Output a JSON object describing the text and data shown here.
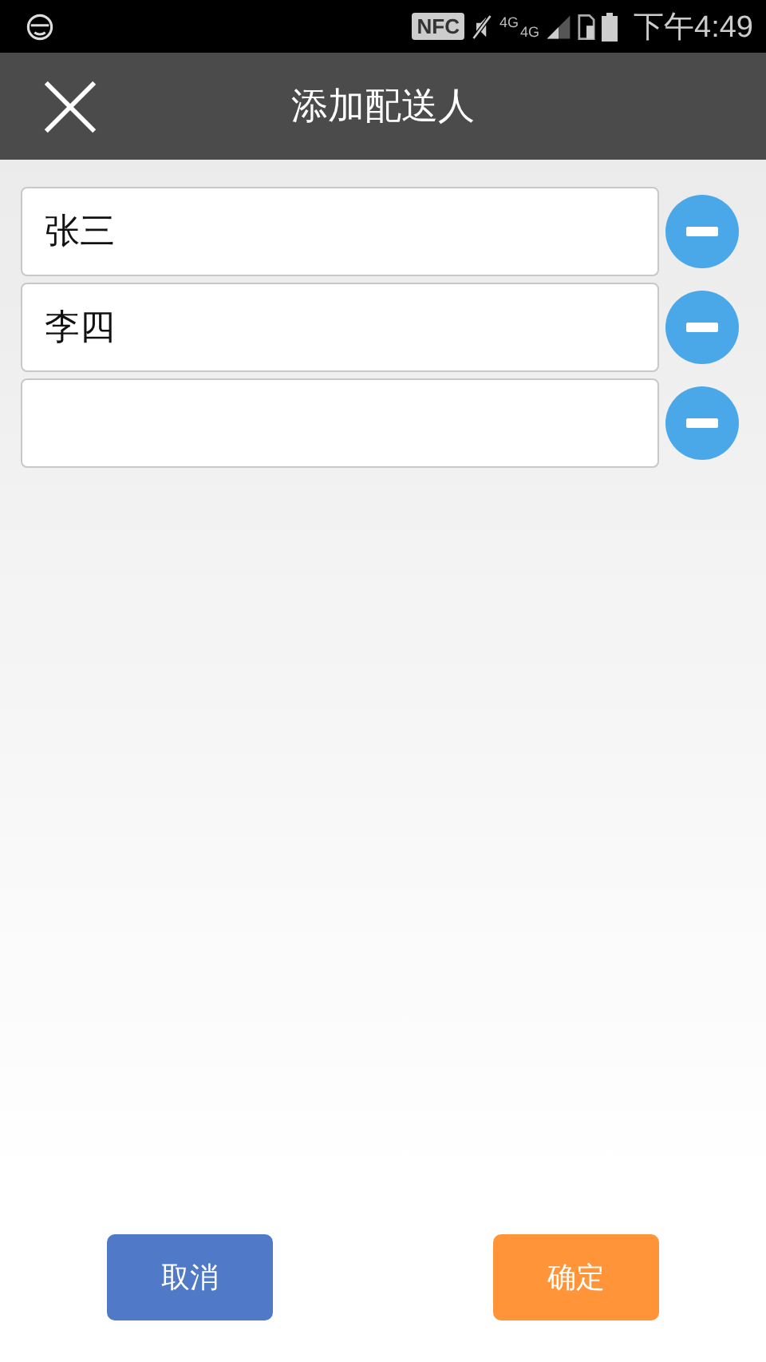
{
  "status_bar": {
    "nfc": "NFC",
    "network_labels": [
      "4G",
      "4G"
    ],
    "time": "下午4:49"
  },
  "header": {
    "title": "添加配送人"
  },
  "entries": [
    {
      "kind": "filled",
      "value": "张三"
    },
    {
      "kind": "filled",
      "value": "李四"
    },
    {
      "kind": "blank"
    }
  ],
  "buttons": [
    {
      "label": "取消",
      "kind": "cancel"
    },
    {
      "label": "确定",
      "kind": "confirm"
    }
  ]
}
